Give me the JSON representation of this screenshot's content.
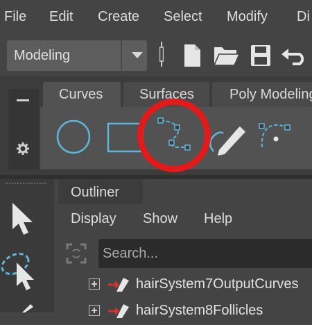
{
  "menu": {
    "items": [
      "File",
      "Edit",
      "Create",
      "Select",
      "Modify",
      "Di"
    ]
  },
  "status_line": {
    "mode_value": "Modeling",
    "icons": [
      "new-scene-icon",
      "open-scene-icon",
      "save-scene-icon",
      "undo-icon"
    ]
  },
  "shelf": {
    "tabs": [
      "Curves",
      "Surfaces",
      "Poly Modeling"
    ],
    "active_tab": "Curves",
    "tools": [
      "circle-tool-icon",
      "square-tool-icon",
      "cv-curve-tool-icon",
      "pencil-curve-tool-icon",
      "arc-tool-icon"
    ]
  },
  "annotation": {
    "color": "#e21a1a",
    "highlighted_tool": "cv-curve-tool-icon"
  },
  "outliner": {
    "tab_label": "Outliner",
    "menu": {
      "display": "Display",
      "show": "Show",
      "help": "Help"
    },
    "search": {
      "placeholder": "Search..."
    },
    "items": [
      {
        "label": "hairSystem7OutputCurves"
      },
      {
        "label": "hairSystem8Follicles"
      }
    ]
  },
  "colors": {
    "accent_cyan": "#5fb6dc",
    "node_red": "#d23232",
    "annotation_red": "#e21a1a"
  }
}
